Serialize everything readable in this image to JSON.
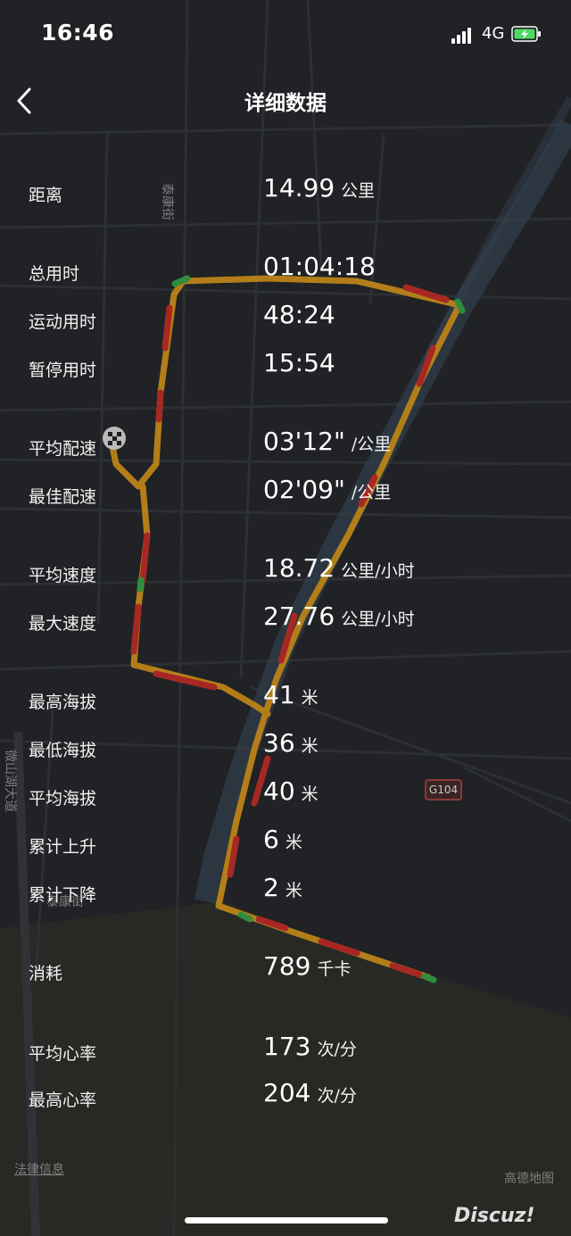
{
  "status_bar": {
    "time": "16:46",
    "network": "4G",
    "signal_icon": "signal-bars-icon",
    "battery_icon": "battery-charging-icon",
    "battery_color": "#4cd964"
  },
  "header": {
    "title": "详细数据",
    "back_icon": "chevron-left-icon"
  },
  "metrics": [
    {
      "label": "距离",
      "value": "14.99",
      "unit": "公里"
    },
    {
      "label": "总用时",
      "value": "01:04:18",
      "unit": ""
    },
    {
      "label": "运动用时",
      "value": "48:24",
      "unit": ""
    },
    {
      "label": "暂停用时",
      "value": "15:54",
      "unit": ""
    },
    {
      "label": "平均配速",
      "value": "03'12\"",
      "unit": "/公里"
    },
    {
      "label": "最佳配速",
      "value": "02'09\"",
      "unit": "/公里"
    },
    {
      "label": "平均速度",
      "value": "18.72",
      "unit": "公里/小时"
    },
    {
      "label": "最大速度",
      "value": "27.76",
      "unit": "公里/小时"
    },
    {
      "label": "最高海拔",
      "value": "41",
      "unit": "米"
    },
    {
      "label": "最低海拔",
      "value": "36",
      "unit": "米"
    },
    {
      "label": "平均海拔",
      "value": "40",
      "unit": "米"
    },
    {
      "label": "累计上升",
      "value": "6",
      "unit": "米"
    },
    {
      "label": "累计下降",
      "value": "2",
      "unit": "米"
    },
    {
      "label": "消耗",
      "value": "789",
      "unit": "千卡"
    },
    {
      "label": "平均心率",
      "value": "173",
      "unit": "次/分"
    },
    {
      "label": "最高心率",
      "value": "204",
      "unit": "次/分"
    }
  ],
  "map": {
    "road_badge": "G104",
    "street_label_1": "泰康街",
    "street_label_2": "泰康街",
    "street_label_3": "微山湖大道",
    "legal_info": "法律信息",
    "provider": "高德地图",
    "finish_icon": "checkered-flag-icon",
    "route_colors": [
      "#e8a21a",
      "#d92f27",
      "#3cb44b"
    ]
  },
  "watermark": "Discuz!"
}
